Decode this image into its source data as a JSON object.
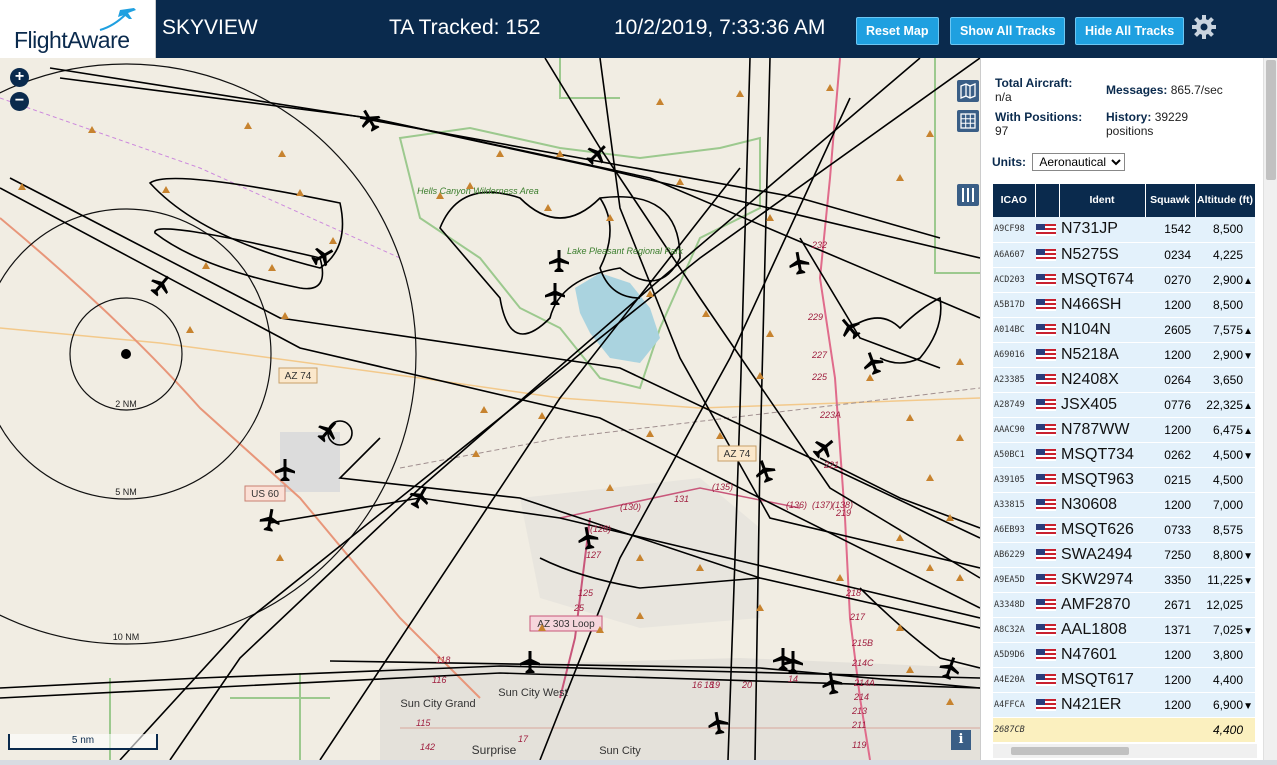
{
  "header": {
    "logo_text": "FlightAware",
    "app_title": "SKYVIEW",
    "tracked_label": "TA Tracked:",
    "tracked_count": "152",
    "clock": "10/2/2019, 7:33:36 AM",
    "buttons": {
      "reset": "Reset Map",
      "show_all": "Show All Tracks",
      "hide_all": "Hide All Tracks"
    }
  },
  "map": {
    "zoom_in": "+",
    "zoom_out": "−",
    "scale_label": "5 nm",
    "info": "i",
    "range_rings": [
      "2 NM",
      "5 NM",
      "10 NM"
    ],
    "road_shields": [
      "AZ 74",
      "US 60",
      "AZ 74",
      "AZ 303 Loop"
    ],
    "places": [
      "Hells Canyon Wilderness Area",
      "Lake Pleasant Regional Park",
      "Sun City West",
      "Sun City Grand",
      "Surprise",
      "Sun City"
    ],
    "route_labels": [
      "(128)",
      "(130)",
      "131",
      "(135)",
      "(136)",
      "(137)",
      "(138)",
      "127",
      "125",
      "25",
      "232",
      "229",
      "227",
      "225",
      "223A",
      "221",
      "219",
      "218",
      "217",
      "215B",
      "214C",
      "214A",
      "214",
      "213",
      "211",
      "119",
      "118",
      "116",
      "115",
      "142",
      "17",
      "16",
      "18",
      "19",
      "20",
      "14"
    ],
    "land_color": "#f1ede3",
    "water_color": "#aad3df",
    "track_color": "#000000"
  },
  "panel": {
    "total_aircraft_label": "Total Aircraft:",
    "total_aircraft_value": "n/a",
    "messages_label": "Messages:",
    "messages_value": "865.7/sec",
    "with_positions_label": "With Positions:",
    "with_positions_value": "97",
    "history_label": "History:",
    "history_value": "39229",
    "history_unit": "positions",
    "units_label": "Units:",
    "units_selected": "Aeronautical",
    "columns": [
      "ICAO",
      "",
      "Ident",
      "Squawk",
      "Altitude (ft)"
    ],
    "rows": [
      {
        "icao": "A9CF98",
        "ident": "N731JP",
        "squawk": "1542",
        "alt": "8,500",
        "trend": ""
      },
      {
        "icao": "A6A607",
        "ident": "N5275S",
        "squawk": "0234",
        "alt": "4,225",
        "trend": ""
      },
      {
        "icao": "ACD203",
        "ident": "MSQT674",
        "squawk": "0270",
        "alt": "2,900",
        "trend": "▲"
      },
      {
        "icao": "A5B17D",
        "ident": "N466SH",
        "squawk": "1200",
        "alt": "8,500",
        "trend": ""
      },
      {
        "icao": "A014BC",
        "ident": "N104N",
        "squawk": "2605",
        "alt": "7,575",
        "trend": "▲"
      },
      {
        "icao": "A69016",
        "ident": "N5218A",
        "squawk": "1200",
        "alt": "2,900",
        "trend": "▼"
      },
      {
        "icao": "A23385",
        "ident": "N2408X",
        "squawk": "0264",
        "alt": "3,650",
        "trend": ""
      },
      {
        "icao": "A28749",
        "ident": "JSX405",
        "squawk": "0776",
        "alt": "22,325",
        "trend": "▲"
      },
      {
        "icao": "AAAC90",
        "ident": "N787WW",
        "squawk": "1200",
        "alt": "6,475",
        "trend": "▲"
      },
      {
        "icao": "A50BC1",
        "ident": "MSQT734",
        "squawk": "0262",
        "alt": "4,500",
        "trend": "▼"
      },
      {
        "icao": "A39105",
        "ident": "MSQT963",
        "squawk": "0215",
        "alt": "4,500",
        "trend": ""
      },
      {
        "icao": "A33815",
        "ident": "N30608",
        "squawk": "1200",
        "alt": "7,000",
        "trend": ""
      },
      {
        "icao": "A6EB93",
        "ident": "MSQT626",
        "squawk": "0733",
        "alt": "8,575",
        "trend": ""
      },
      {
        "icao": "AB6229",
        "ident": "SWA2494",
        "squawk": "7250",
        "alt": "8,800",
        "trend": "▼"
      },
      {
        "icao": "A9EA5D",
        "ident": "SKW2974",
        "squawk": "3350",
        "alt": "11,225",
        "trend": "▼"
      },
      {
        "icao": "A3348D",
        "ident": "AMF2870",
        "squawk": "2671",
        "alt": "12,025",
        "trend": ""
      },
      {
        "icao": "A8C32A",
        "ident": "AAL1808",
        "squawk": "1371",
        "alt": "7,025",
        "trend": "▼"
      },
      {
        "icao": "A5D9D6",
        "ident": "N47601",
        "squawk": "1200",
        "alt": "3,800",
        "trend": ""
      },
      {
        "icao": "A4E20A",
        "ident": "MSQT617",
        "squawk": "1200",
        "alt": "4,400",
        "trend": ""
      },
      {
        "icao": "A4FFCA",
        "ident": "N421ER",
        "squawk": "1200",
        "alt": "6,900",
        "trend": "▼"
      },
      {
        "icao": "2687CB",
        "ident": "",
        "squawk": "",
        "alt": "4,400",
        "trend": "",
        "flag": false,
        "selected": true
      }
    ]
  }
}
